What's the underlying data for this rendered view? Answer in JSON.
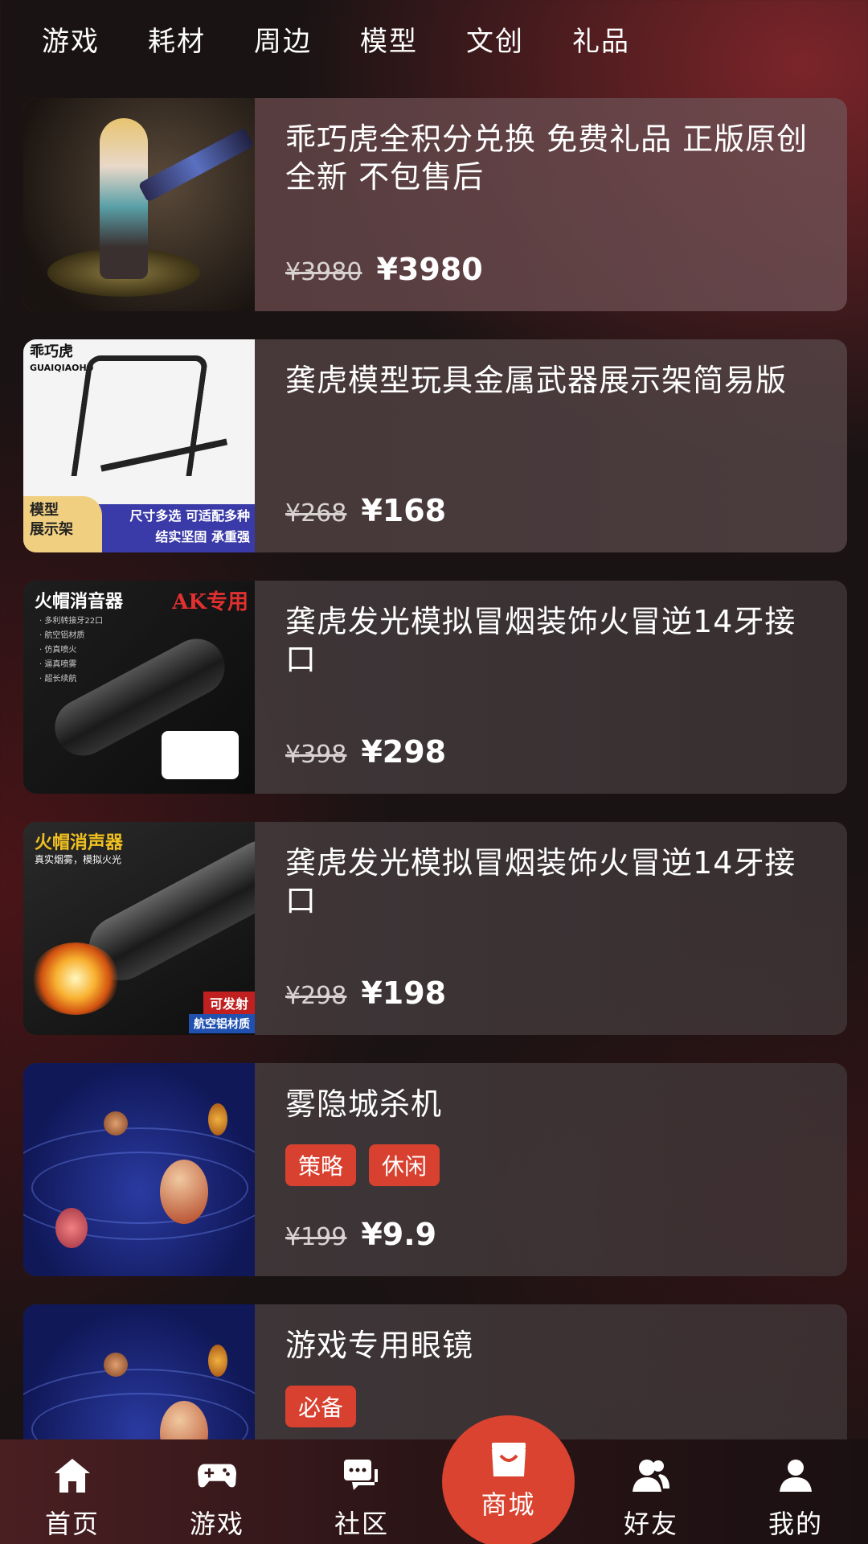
{
  "tabs": [
    "游戏",
    "耗材",
    "周边",
    "模型",
    "文创",
    "礼品"
  ],
  "products": [
    {
      "title": "乖巧虎全积分兑换 免费礼品 正版原创全新 不包售后",
      "old_price": "¥3980",
      "new_price": "¥3980",
      "thumb": "figure"
    },
    {
      "title": "龚虎模型玩具金属武器展示架简易版",
      "old_price": "¥268",
      "new_price": "¥168",
      "thumb": "rack",
      "thumb_text": {
        "brand": "乖巧虎",
        "brand_en": "GUAIQIAOHU",
        "left_label_1": "模型",
        "left_label_2": "展示架",
        "right_label_1": "尺寸多选 可适配多种",
        "right_label_2": "结实坚固 承重强"
      }
    },
    {
      "title": "龚虎发光模拟冒烟装饰火冒逆14牙接口",
      "old_price": "¥398",
      "new_price": "¥298",
      "thumb": "silencer",
      "thumb_text": {
        "label": "火帽消音器",
        "ak": "AK专用",
        "features": [
          "· 多利转接牙22口",
          "· 航空铝材质",
          "· 仿真喷火",
          "· 逼真喷雾",
          "· 超长续航"
        ]
      }
    },
    {
      "title": "龚虎发光模拟冒烟装饰火冒逆14牙接口",
      "old_price": "¥298",
      "new_price": "¥198",
      "thumb": "muzzle",
      "thumb_text": {
        "label": "火帽消声器",
        "sub": "真实烟雾，模拟火光",
        "badge1": "可发射",
        "badge2": "航空铝材质"
      }
    },
    {
      "title": "雾隐城杀机",
      "tags": [
        "策略",
        "休闲"
      ],
      "old_price": "¥199",
      "new_price": "¥9.9",
      "thumb": "space"
    },
    {
      "title": "游戏专用眼镜",
      "tags": [
        "必备"
      ],
      "thumb": "space"
    }
  ],
  "bottom_nav": [
    {
      "label": "首页",
      "icon": "home-icon"
    },
    {
      "label": "游戏",
      "icon": "gamepad-icon"
    },
    {
      "label": "社区",
      "icon": "chat-icon"
    },
    {
      "label": "商城",
      "icon": "shopping-bag-icon",
      "active": true
    },
    {
      "label": "好友",
      "icon": "friends-icon"
    },
    {
      "label": "我的",
      "icon": "user-icon"
    }
  ],
  "colors": {
    "accent": "#d9432f",
    "tag": "#d8412f"
  }
}
